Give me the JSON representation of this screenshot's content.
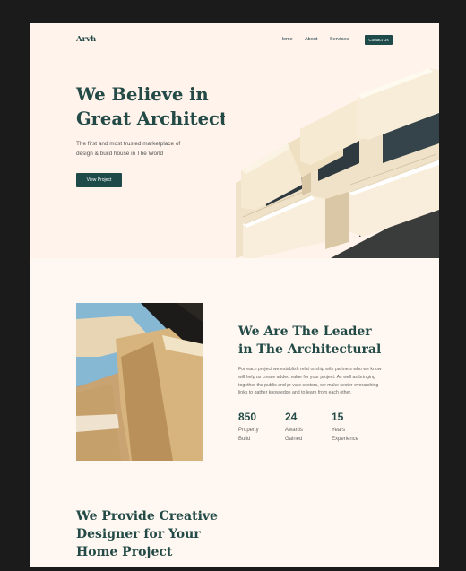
{
  "header": {
    "brand": "Arvh",
    "nav": [
      "Home",
      "About",
      "Services"
    ],
    "contact_label": "Contact Us"
  },
  "hero": {
    "title_line1": "We Believe in",
    "title_line2": "Great Architecture",
    "subtitle_line1": "The first and most trusted marketplace of",
    "subtitle_line2": "design & build house in The World",
    "cta_label": "View Project"
  },
  "about": {
    "title_line1": "We Are The Leader",
    "title_line2": "in The Architectural",
    "desc_line1": "For each project we establish relat onship with partners who we know",
    "desc_line2": "will help us create added value for your project. As well as bringing",
    "desc_line3": "together the public and pr vate sectors, we make sector-overarching",
    "desc_line4": "links to gather knowledge and to learn from each other.",
    "stats": [
      {
        "number": "850",
        "label_line1": "Property",
        "label_line2": "Build"
      },
      {
        "number": "24",
        "label_line1": "Awards",
        "label_line2": "Gained"
      },
      {
        "number": "15",
        "label_line1": "Years",
        "label_line2": "Experience"
      }
    ]
  },
  "services": {
    "title_line1": "We Provide Creative",
    "title_line2": "Designer for Your",
    "title_line3": "Home Project"
  },
  "colors": {
    "brand_dark_green": "#1f4a4a",
    "heading_green": "#234a46",
    "page_background": "#fff8f2",
    "outer_background": "#1b1b1b"
  }
}
